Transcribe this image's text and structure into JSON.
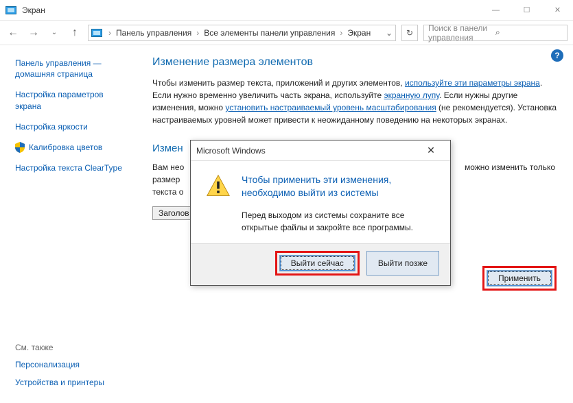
{
  "window": {
    "title": "Экран",
    "minimize": "—",
    "maximize": "☐",
    "close": "✕"
  },
  "toolbar": {
    "back": "←",
    "forward": "→",
    "up": "↑",
    "breadcrumb": {
      "item1": "Панель управления",
      "item2": "Все элементы панели управления",
      "item3": "Экран",
      "sep": "›",
      "dropdown": "⌄"
    },
    "refresh": "↻",
    "search_placeholder": "Поиск в панели управления",
    "search_icon": "⌕"
  },
  "sidebar": {
    "home": "Панель управления — домашняя страница",
    "link1": "Настройка параметров экрана",
    "link2": "Настройка яркости",
    "link3": "Калибровка цветов",
    "link4": "Настройка текста ClearType",
    "see_also_heading": "См. также",
    "see_also1": "Персонализация",
    "see_also2": "Устройства и принтеры"
  },
  "main": {
    "help": "?",
    "h1": "Изменение размера элементов",
    "p1_a": "Чтобы изменить размер текста, приложений и других элементов, ",
    "p1_link1": "используйте эти параметры экрана",
    "p1_b": ". Если нужно временно увеличить часть экрана, используйте ",
    "p1_link2": "экранную лупу",
    "p1_c": ". Если нужны другие изменения, можно ",
    "p1_link3": "установить настраиваемый уровень масштабирования",
    "p1_d": " (не рекомендуется). Установка настраиваемых уровней может привести к неожиданному поведению на некоторых экранах.",
    "h2_prefix": "Измен",
    "desc2_a": "Вам нео",
    "desc2_b": " можно изменить только размер",
    "desc2_c": "текста о",
    "dropdown_value": "Заголов",
    "apply": "Применить"
  },
  "dialog": {
    "title": "Microsoft Windows",
    "close": "✕",
    "heading": "Чтобы применить эти изменения, необходимо выйти из системы",
    "body": "Перед выходом из системы сохраните все открытые файлы и закройте все программы.",
    "primary": "Выйти сейчас",
    "secondary": "Выйти позже"
  }
}
